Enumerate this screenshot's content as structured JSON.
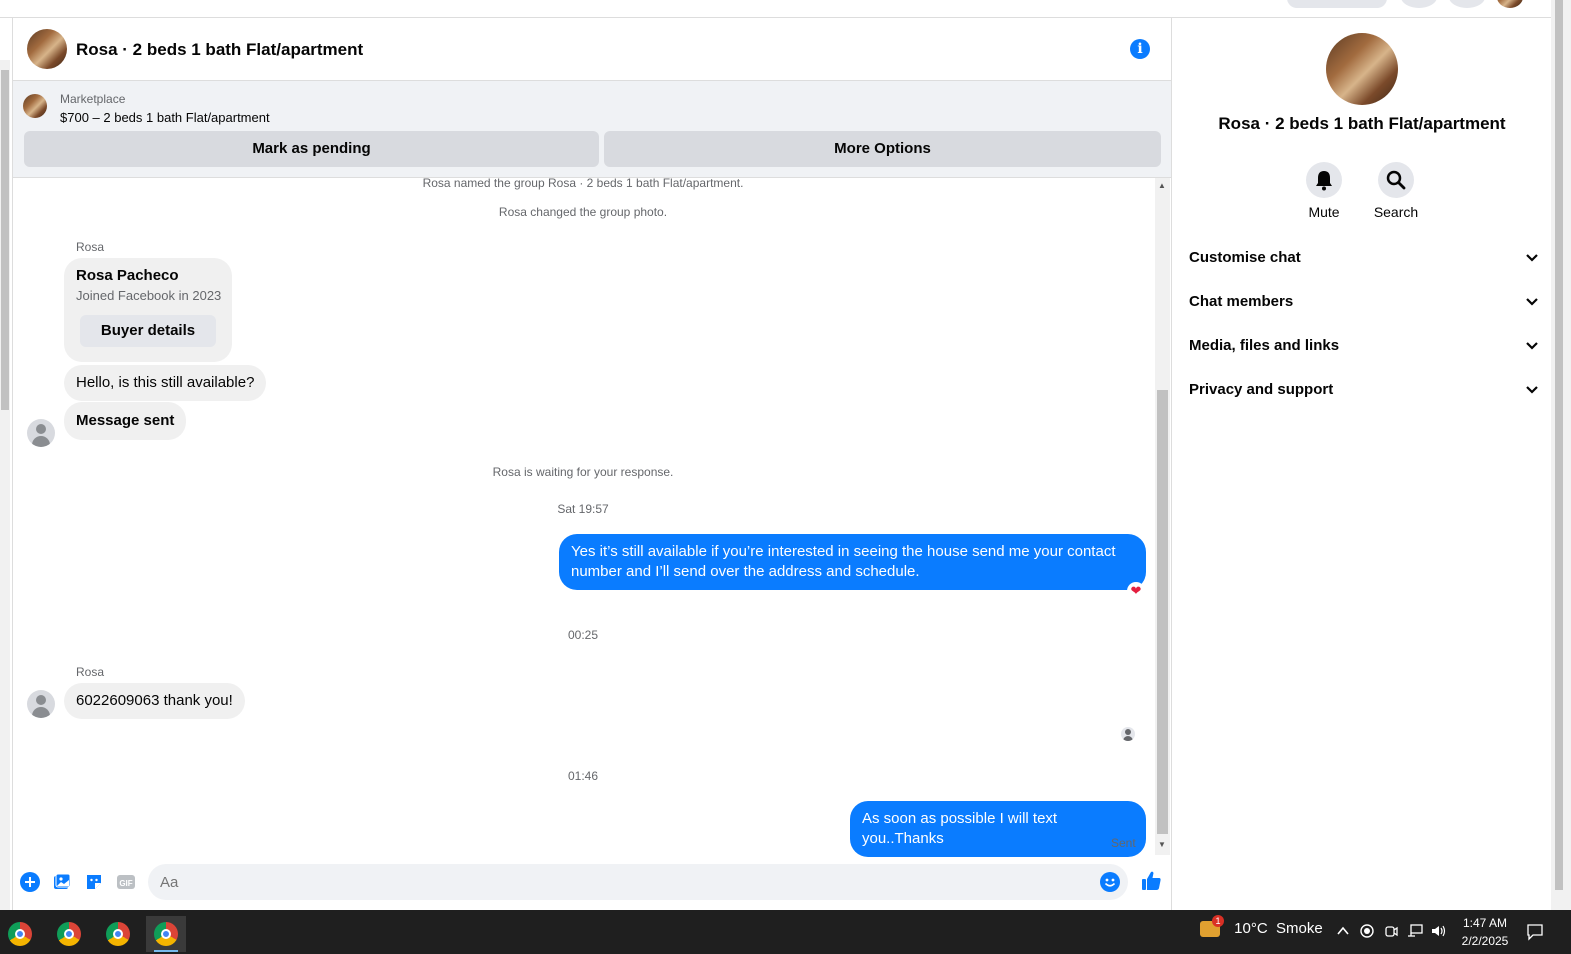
{
  "chat": {
    "title": "Rosa · 2 beds 1 bath Flat/apartment",
    "marketplace_label": "Marketplace",
    "listing_title": "$700 – 2 beds 1 bath Flat/apartment",
    "mark_pending_label": "Mark as pending",
    "more_options_label": "More Options",
    "accent_color": "#0a7cff"
  },
  "messages": {
    "sys_named": "Rosa named the group Rosa · 2 beds 1 bath Flat/apartment.",
    "sys_photo": "Rosa changed the group photo.",
    "sender_1": "Rosa",
    "card_name": "Rosa Pacheco",
    "card_joined": "Joined Facebook in 2023",
    "card_button": "Buyer details",
    "msg_hello": "Hello, is this still available?",
    "msg_sent_auto": "Message sent",
    "sys_waiting": "Rosa is waiting for your response.",
    "time_1": "Sat 19:57",
    "msg_out_1": "Yes it’s still available if you’re interested in seeing the house send me your contact number and I’ll send over the address and schedule.",
    "time_2": "00:25",
    "sender_2": "Rosa",
    "msg_in_2": "6022609063 thank you!",
    "time_3": "01:46",
    "msg_out_2": "As soon as possible I will text you..Thanks",
    "status_sent": "Sent"
  },
  "composer": {
    "placeholder": "Aa",
    "gif_label": "GIF",
    "icons": [
      "plus-circle-icon",
      "photo-icon",
      "sticker-icon",
      "gif-icon",
      "emoji-icon",
      "thumbs-up-icon"
    ]
  },
  "side": {
    "title": "Rosa · 2 beds 1 bath Flat/apartment",
    "mute_label": "Mute",
    "search_label": "Search",
    "sections": [
      {
        "label": "Customise chat"
      },
      {
        "label": "Chat members"
      },
      {
        "label": "Media, files and links"
      },
      {
        "label": "Privacy and support"
      }
    ]
  },
  "taskbar": {
    "weather": "10°C  Smoke",
    "weather_badge": "1",
    "time": "1:47 AM",
    "date": "2/2/2025"
  }
}
